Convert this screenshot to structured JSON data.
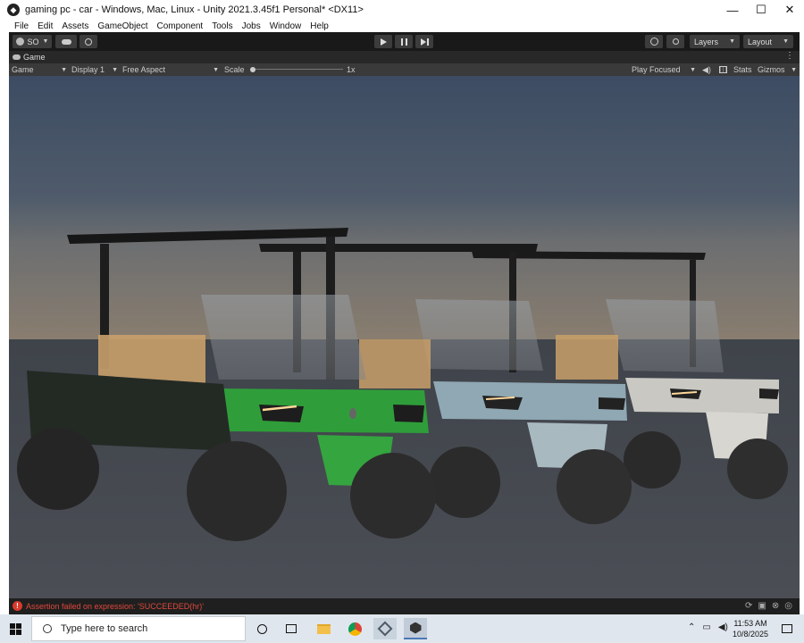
{
  "window": {
    "title": "gaming pc - car - Windows, Mac, Linux - Unity 2021.3.45f1 Personal* <DX11>",
    "controls": {
      "minimize": "—",
      "maximize": "☐",
      "close": "✕"
    }
  },
  "menu": [
    "File",
    "Edit",
    "Assets",
    "GameObject",
    "Component",
    "Tools",
    "Jobs",
    "Window",
    "Help"
  ],
  "toolbar": {
    "account_label": "SO",
    "layers_label": "Layers",
    "layout_label": "Layout"
  },
  "game_tab": {
    "label": "Game"
  },
  "game_view_bar": {
    "view_select": "Game",
    "display_select": "Display 1",
    "aspect_select": "Free Aspect",
    "scale_label": "Scale",
    "scale_value": "1x",
    "play_mode_select": "Play Focused",
    "stats_label": "Stats",
    "gizmos_label": "Gizmos"
  },
  "status": {
    "error_message": "Assertion failed on expression: 'SUCCEEDED(hr)'"
  },
  "taskbar": {
    "search_placeholder": "Type here to search",
    "time": "11:53 AM",
    "date": "10/8/2025"
  },
  "scene": {
    "description_colors": {
      "green_cart": "#2f9e3a",
      "blue_cart": "#8fa8b3",
      "white_cart": "#c9c8c3",
      "seat": "#d8b079"
    }
  }
}
